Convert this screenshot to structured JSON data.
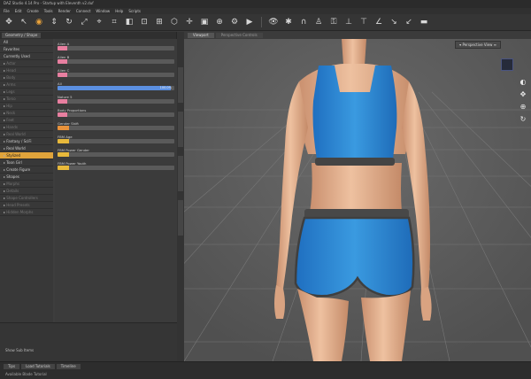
{
  "titlebar": {
    "title": "DAZ Studio 4.14 Pro - Startup with Eleventh v2.duf"
  },
  "menubar": {
    "items": [
      "File",
      "Edit",
      "Create",
      "Tools",
      "Render",
      "Connect",
      "Window",
      "Help",
      "Scripts"
    ]
  },
  "left_panel": {
    "tabs": [
      "Geometry / Shape"
    ],
    "categories": [
      {
        "label": "All",
        "state": "normal"
      },
      {
        "label": "Favorites",
        "state": "normal"
      },
      {
        "label": "Currently Used",
        "state": "normal"
      },
      {
        "label": "Actor",
        "state": "dim"
      },
      {
        "label": "Head",
        "state": "dim"
      },
      {
        "label": "Body",
        "state": "dim"
      },
      {
        "label": "Arms",
        "state": "dim"
      },
      {
        "label": "Legs",
        "state": "dim"
      },
      {
        "label": "Torso",
        "state": "dim"
      },
      {
        "label": "Hip",
        "state": "dim"
      },
      {
        "label": "Neck",
        "state": "dim"
      },
      {
        "label": "Feet",
        "state": "dim"
      },
      {
        "label": "Hands",
        "state": "dim"
      },
      {
        "label": "Real World",
        "state": "dim"
      },
      {
        "label": "Fantasy / SciFi",
        "state": "normal"
      },
      {
        "label": "Real World",
        "state": "normal"
      },
      {
        "label": "Stylized",
        "state": "selected"
      },
      {
        "label": "Toon Girl",
        "state": "normal"
      },
      {
        "label": "Create Figure",
        "state": "normal"
      },
      {
        "label": "Shapes",
        "state": "normal"
      },
      {
        "label": "Morphs",
        "state": "dim"
      },
      {
        "label": "Details",
        "state": "dim"
      },
      {
        "label": "Shape Controllers",
        "state": "dim"
      },
      {
        "label": "Head Presets",
        "state": "dim"
      },
      {
        "label": "Hidden Morphs",
        "state": "dim"
      }
    ],
    "sliders": [
      {
        "label": "Alien A",
        "color": "#e87fa0",
        "fill": 0.08
      },
      {
        "label": "Alien B",
        "color": "#e87fa0",
        "fill": 0.08
      },
      {
        "label": "Alien C",
        "color": "#e87fa0",
        "fill": 0.08
      },
      {
        "label": "All",
        "color": "#5b8fe0",
        "fill": 0.97,
        "value": "100.0%"
      },
      {
        "label": "Nature 5",
        "color": "#e87fa0",
        "fill": 0.08
      },
      {
        "label": "Body Proportions",
        "color": "#e87fa0",
        "fill": 0.08
      },
      {
        "label": "Gender Shift",
        "color": "#e8923b",
        "fill": 0.1
      },
      {
        "label": "FBM Age",
        "color": "#e8b93b",
        "fill": 0.1
      },
      {
        "label": "FBM Power Gender",
        "color": "#e8b93b",
        "fill": 0.1
      },
      {
        "label": "FBM Power Youth",
        "color": "#e8b93b",
        "fill": 0.1
      }
    ],
    "bottom_hint": "Show Sub Items"
  },
  "statusbar": {
    "tabs": [
      "Tips",
      "Load Tutorials"
    ],
    "tab2": "Timeline",
    "status": "Available Blade Tutorial"
  },
  "viewport": {
    "tabs": [
      "Viewport",
      "Perspective Controls"
    ],
    "camera_label": "Perspective View"
  },
  "colors": {
    "accent_orange": "#e0a43b",
    "top_blue": "#2f7fd0",
    "shorts_blue": "#3392d8",
    "trim_gray": "#444444",
    "skin": "#e3b08c"
  }
}
